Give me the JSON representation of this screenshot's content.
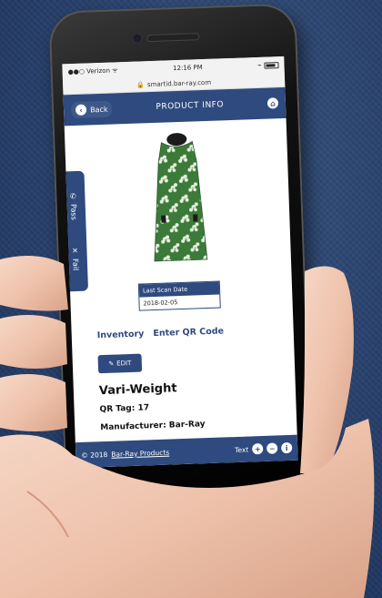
{
  "status_bar": {
    "carrier": "Verizon",
    "time": "12:16 PM",
    "url": "smartid.bar-ray.com"
  },
  "header": {
    "back_label": "Back",
    "title": "PRODUCT INFO"
  },
  "side_tab": {
    "items": [
      {
        "icon": "phone-icon",
        "label": "Pass"
      },
      {
        "icon": "close-icon",
        "label": "Fail"
      }
    ]
  },
  "scan": {
    "label": "Last Scan Date",
    "value": "2018-02-05"
  },
  "links": {
    "inventory": "Inventory",
    "qr": "Enter QR Code"
  },
  "edit": {
    "label": "EDIT"
  },
  "product": {
    "title": "Vari-Weight",
    "qr_tag": "QR Tag: 17",
    "manufacturer": "Manufacturer: Bar-Ray"
  },
  "footer": {
    "copyright": "© 2018",
    "company": "Bar-Ray Products",
    "text_label": "Text"
  },
  "colors": {
    "brand": "#2e4a7e",
    "dress_green": "#3c7a3a"
  }
}
